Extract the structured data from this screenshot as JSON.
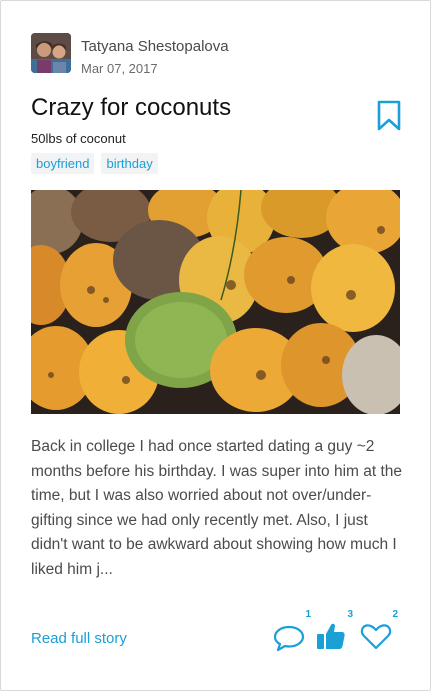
{
  "author": {
    "name": "Tatyana Shestopalova",
    "date": "Mar 07, 2017"
  },
  "post": {
    "title": "Crazy for coconuts",
    "subtitle": "50lbs of coconut",
    "tags": [
      "boyfriend",
      "birthday"
    ],
    "excerpt": "Back in college I had once started dating a guy ~2 months before his birthday. I was super into him at the time, but I was also worried about not over/under-gifting since we had only recently met. Also, I just didn't want to be awkward about showing how much I liked him j..."
  },
  "footer": {
    "read_more": "Read full story",
    "comments_count": "1",
    "likes_count": "3",
    "hearts_count": "2"
  },
  "colors": {
    "accent": "#1a9fd6",
    "tag_bg": "#f1f3f4",
    "text": "#4b4b4b"
  },
  "icons": [
    "bookmark-icon",
    "comment-icon",
    "thumbs-up-icon",
    "heart-icon"
  ]
}
